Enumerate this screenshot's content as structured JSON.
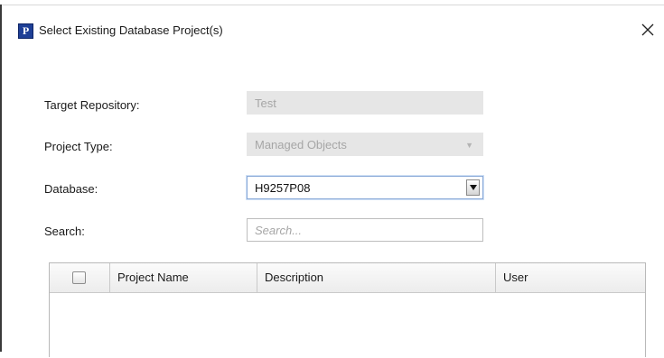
{
  "dialog": {
    "title": "Select Existing Database Project(s)",
    "app_icon_letter": "P",
    "close_glyph": "close-icon"
  },
  "form": {
    "target_repository": {
      "label": "Target Repository:",
      "value": "Test"
    },
    "project_type": {
      "label": "Project Type:",
      "value": "Managed Objects",
      "icon": "chevron-down-icon"
    },
    "database": {
      "label": "Database:",
      "value": "H9257P08",
      "icon": "triangle-down-icon"
    },
    "search": {
      "label": "Search:",
      "placeholder": "Search...",
      "value": ""
    }
  },
  "table": {
    "columns": [
      "",
      "Project Name",
      "Description",
      "User"
    ],
    "rows": []
  },
  "colors": {
    "app_icon": "#1e3f96",
    "disabled_field_bg": "#e6e6e6",
    "disabled_text": "#a6a6a6",
    "focus_border": "#8aa9d8"
  }
}
